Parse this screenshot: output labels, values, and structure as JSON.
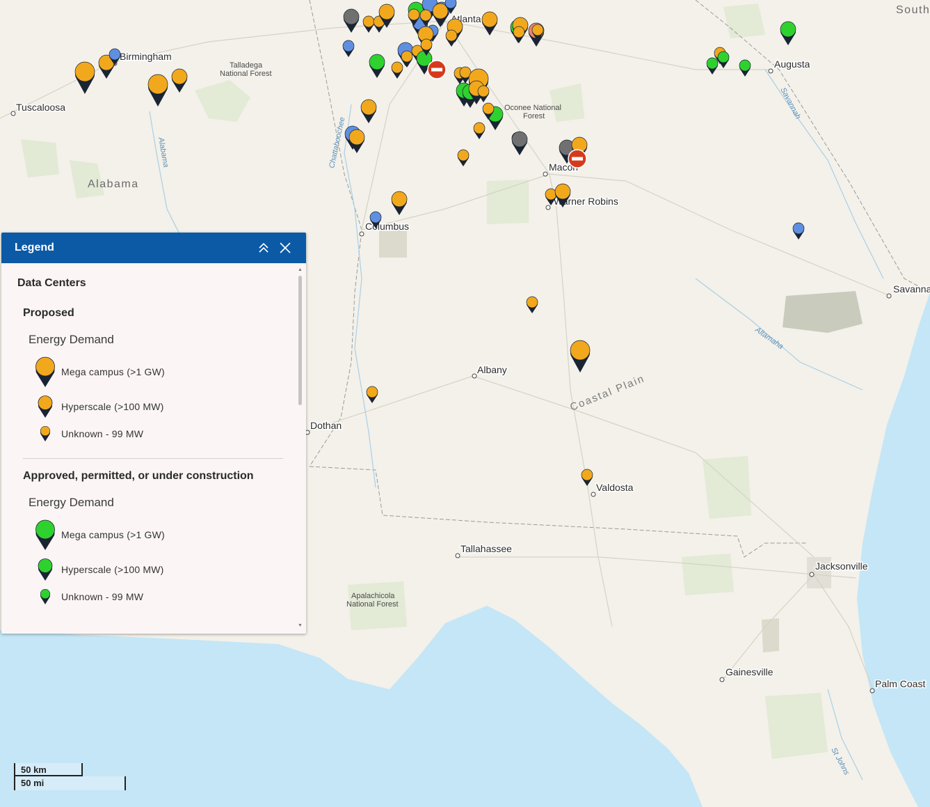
{
  "map": {
    "labels": {
      "cities": [
        {
          "id": "birmingham",
          "name": "Birmingham"
        },
        {
          "id": "tuscaloosa",
          "name": "Tuscaloosa"
        },
        {
          "id": "atlanta",
          "name": "Atlanta"
        },
        {
          "id": "augusta",
          "name": "Augusta"
        },
        {
          "id": "macon",
          "name": "Macon"
        },
        {
          "id": "warner-robins",
          "name": "Warner Robins"
        },
        {
          "id": "columbus",
          "name": "Columbus"
        },
        {
          "id": "savannah",
          "name": "Savanna"
        },
        {
          "id": "albany",
          "name": "Albany"
        },
        {
          "id": "dothan",
          "name": "Dothan"
        },
        {
          "id": "valdosta",
          "name": "Valdosta"
        },
        {
          "id": "tallahassee",
          "name": "Tallahassee"
        },
        {
          "id": "jacksonville",
          "name": "Jacksonville"
        },
        {
          "id": "gainesville",
          "name": "Gainesville"
        },
        {
          "id": "palm-coast",
          "name": "Palm Coast"
        }
      ],
      "state": "Alabama",
      "state_top_right": "South Caroli",
      "parks": {
        "talladega_1": "Talladega",
        "talladega_2": "National Forest",
        "oconee_1": "Oconee National",
        "oconee_2": "Forest",
        "apalachicola_1": "Apalachicola",
        "apalachicola_2": "National Forest"
      },
      "rivers": {
        "alabama": "Alabama",
        "chattahoochee": "Chattahoochee",
        "savannah": "Savannah",
        "altamaha": "Altamaha",
        "st_johns": "St Johns"
      },
      "region": "Coastal Plain"
    },
    "colors": {
      "proposed": "#f2a81d",
      "approved": "#2fd12f",
      "blue": "#5f8fe0",
      "gray": "#707070",
      "salmon": "#e9866f",
      "no_entry": "#d63a1c",
      "pin_shadow": "#1a2433",
      "water": "#c4e6f6",
      "land": "#f3f1ea"
    }
  },
  "legend": {
    "title": "Legend",
    "collapse_icon": "chevron-double-up-icon",
    "close_icon": "close-icon",
    "layer": "Data Centers",
    "groups": [
      {
        "name": "Proposed",
        "field": "Energy Demand",
        "color": "#f2a81d",
        "items": [
          {
            "label": "Mega campus (>1 GW)",
            "size": "large"
          },
          {
            "label": "Hyperscale (>100 MW)",
            "size": "medium"
          },
          {
            "label": "Unknown - 99 MW",
            "size": "small"
          }
        ]
      },
      {
        "name": "Approved, permitted, or under construction",
        "field": "Energy Demand",
        "color": "#2fd12f",
        "items": [
          {
            "label": "Mega campus (>1 GW)",
            "size": "large"
          },
          {
            "label": "Hyperscale (>100 MW)",
            "size": "medium"
          },
          {
            "label": "Unknown - 99 MW",
            "size": "small"
          }
        ]
      }
    ]
  },
  "scale": {
    "km_label": "50 km",
    "mi_label": "50 mi"
  }
}
